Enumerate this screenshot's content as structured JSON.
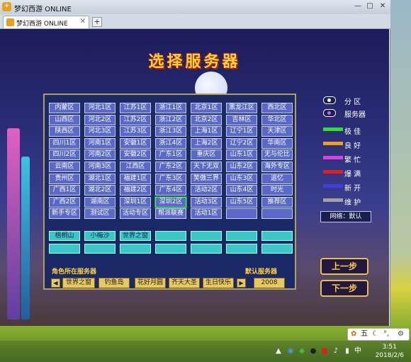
{
  "window": {
    "title": "梦幻西游 ONLINE",
    "controls": {
      "minimize": "—",
      "maximize": "□",
      "close": "✕"
    }
  },
  "tab": {
    "label": "梦幻西游 ONLINE",
    "close": "✕",
    "new": "+"
  },
  "game": {
    "heading": "选择服务器",
    "servers": [
      [
        "内蒙区",
        "河北1区",
        "江苏1区",
        "浙江1区",
        "北京1区",
        "黑龙江区",
        "西北区"
      ],
      [
        "山西区",
        "河北2区",
        "江苏2区",
        "浙江2区",
        "北京2区",
        "吉林区",
        "华北区"
      ],
      [
        "陕西区",
        "河北3区",
        "江苏3区",
        "浙江3区",
        "上海1区",
        "辽宁1区",
        "天津区"
      ],
      [
        "四川1区",
        "河南1区",
        "安徽1区",
        "浙江4区",
        "上海2区",
        "辽宁2区",
        "华南区"
      ],
      [
        "四川2区",
        "河南2区",
        "安徽2区",
        "广东1区",
        "重庆区",
        "山东1区",
        "无与伦比"
      ],
      [
        "云南区",
        "河南3区",
        "江西区",
        "广东2区",
        "天下无双",
        "山东2区",
        "海外专区"
      ],
      [
        "贵州区",
        "湖北1区",
        "福建1区",
        "广东3区",
        "笑傲三界",
        "山东3区",
        "追忆"
      ],
      [
        "广西1区",
        "湖北2区",
        "福建2区",
        "广东4区",
        "活动2区",
        "山东4区",
        "时光"
      ],
      [
        "广西2区",
        "湖南区",
        "深圳1区",
        "深圳2区",
        "活动3区",
        "山东5区",
        "推荐区"
      ],
      [
        "新手专区",
        "测试区",
        "活动专区",
        "帮派联赛",
        "活动1区",
        "",
        ""
      ]
    ],
    "selected_server": "深圳2区",
    "character_slots": [
      [
        "梧桐山",
        "小梅沙",
        "世界之窗",
        "",
        "",
        "",
        ""
      ],
      [
        "",
        "",
        "",
        "",
        "",
        "",
        ""
      ]
    ],
    "role_server_label": "角色所在服务器",
    "default_server_label": "默认服务器",
    "recent_servers": [
      "世界之窗",
      "钓鱼岛",
      "花好月圆",
      "齐天大圣",
      "生日快乐"
    ],
    "default_server_value": "2008",
    "prev_arrow": "◀",
    "next_arrow": "▶",
    "legend": [
      {
        "label": "分 区",
        "color": "#ffffff",
        "kind": "ring"
      },
      {
        "label": "服务器",
        "color": "#c060ff",
        "kind": "ring"
      },
      {
        "label": "极 佳",
        "color": "#30e030",
        "kind": "bar"
      },
      {
        "label": "良 好",
        "color": "#f0a020",
        "kind": "bar"
      },
      {
        "label": "繁 忙",
        "color": "#e040e0",
        "kind": "bar"
      },
      {
        "label": "爆 满",
        "color": "#e02020",
        "kind": "bar"
      },
      {
        "label": "新 开",
        "color": "#4040e0",
        "kind": "bar"
      },
      {
        "label": "维 护",
        "color": "#a0a0a0",
        "kind": "bar"
      }
    ],
    "network_label": "网络：默认",
    "prev_button": "上一步",
    "next_button": "下一步"
  },
  "taskbar": {
    "time": "3:51",
    "date": "2018/2/6",
    "ime_label": "五"
  }
}
